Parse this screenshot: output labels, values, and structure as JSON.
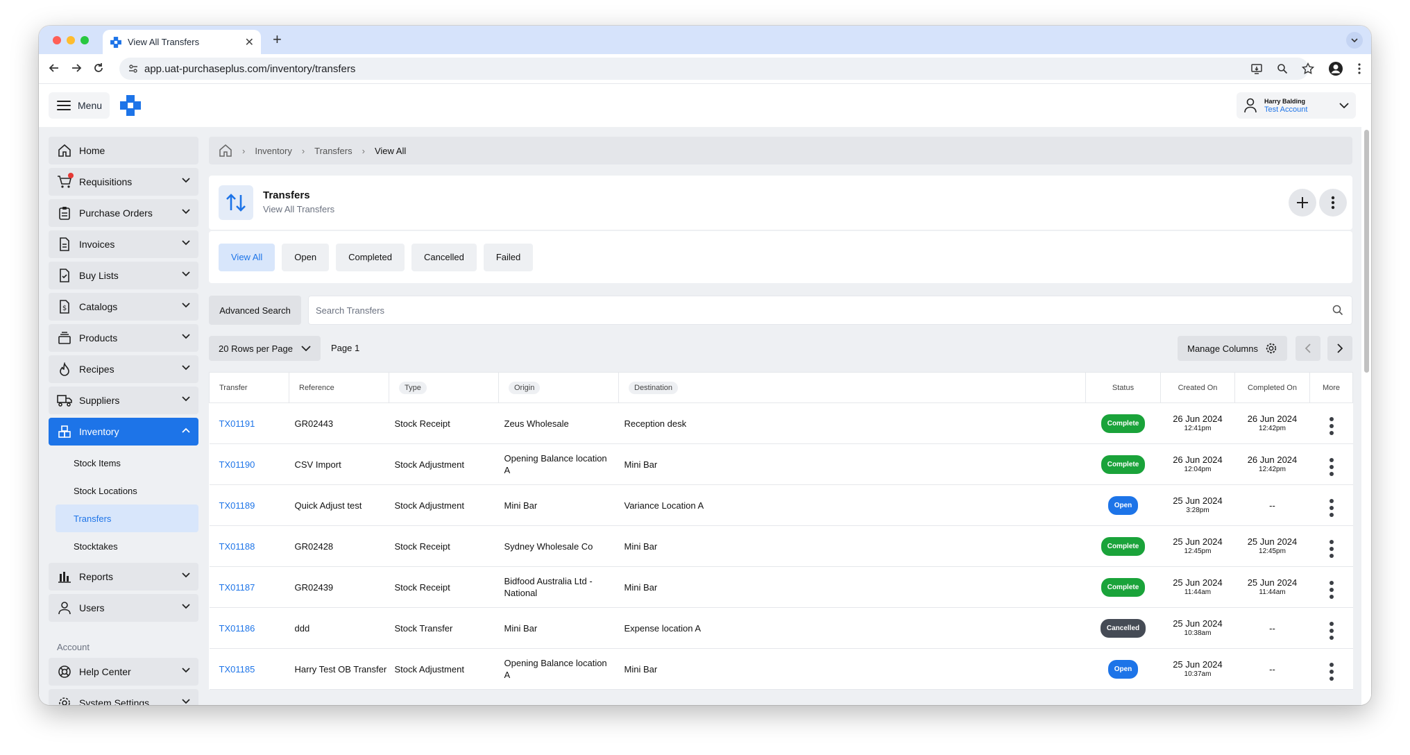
{
  "browser": {
    "tab_title": "View All Transfers",
    "url": "app.uat-purchaseplus.com/inventory/transfers"
  },
  "header": {
    "menu_label": "Menu",
    "user_name": "Harry Balding",
    "account_name": "Test Account"
  },
  "sidebar": {
    "items": [
      {
        "label": "Home",
        "icon": "home-icon"
      },
      {
        "label": "Requisitions",
        "icon": "cart-icon"
      },
      {
        "label": "Purchase Orders",
        "icon": "clipboard-icon"
      },
      {
        "label": "Invoices",
        "icon": "document-icon"
      },
      {
        "label": "Buy Lists",
        "icon": "checklist-icon"
      },
      {
        "label": "Catalogs",
        "icon": "dollar-doc-icon"
      },
      {
        "label": "Products",
        "icon": "stack-icon"
      },
      {
        "label": "Recipes",
        "icon": "flame-icon"
      },
      {
        "label": "Suppliers",
        "icon": "truck-icon"
      },
      {
        "label": "Inventory",
        "icon": "boxes-icon"
      }
    ],
    "inventory_sub": [
      "Stock Items",
      "Stock Locations",
      "Transfers",
      "Stocktakes"
    ],
    "more_items": [
      {
        "label": "Reports",
        "icon": "bar-chart-icon"
      },
      {
        "label": "Users",
        "icon": "user-icon"
      }
    ],
    "account_heading": "Account",
    "account_items": [
      {
        "label": "Help Center",
        "icon": "lifebuoy-icon"
      },
      {
        "label": "System Settings",
        "icon": "gear-icon"
      }
    ]
  },
  "breadcrumb": [
    "Inventory",
    "Transfers",
    "View All"
  ],
  "page": {
    "title": "Transfers",
    "subtitle": "View All Transfers"
  },
  "filters": [
    "View All",
    "Open",
    "Completed",
    "Cancelled",
    "Failed"
  ],
  "search": {
    "advanced_label": "Advanced Search",
    "placeholder": "Search Transfers"
  },
  "pagination": {
    "rows_per_page": "20 Rows per Page",
    "page_label": "Page 1",
    "manage_columns": "Manage Columns"
  },
  "table": {
    "headers": [
      "Transfer",
      "Reference",
      "Type",
      "Origin",
      "Destination",
      "Status",
      "Created On",
      "Completed On",
      "More"
    ],
    "rows": [
      {
        "transfer": "TX01191",
        "reference": "GR02443",
        "type": "Stock Receipt",
        "origin": "Zeus Wholesale",
        "destination": "Reception desk",
        "status": "Complete",
        "created_date": "26 Jun 2024",
        "created_time": "12:41pm",
        "completed_date": "26 Jun 2024",
        "completed_time": "12:42pm"
      },
      {
        "transfer": "TX01190",
        "reference": "CSV Import",
        "type": "Stock Adjustment",
        "origin": "Opening Balance location A",
        "destination": "Mini Bar",
        "status": "Complete",
        "created_date": "26 Jun 2024",
        "created_time": "12:04pm",
        "completed_date": "26 Jun 2024",
        "completed_time": "12:42pm"
      },
      {
        "transfer": "TX01189",
        "reference": "Quick Adjust test",
        "type": "Stock Adjustment",
        "origin": "Mini Bar",
        "destination": "Variance Location A",
        "status": "Open",
        "created_date": "25 Jun 2024",
        "created_time": "3:28pm",
        "completed_date": "--",
        "completed_time": ""
      },
      {
        "transfer": "TX01188",
        "reference": "GR02428",
        "type": "Stock Receipt",
        "origin": "Sydney Wholesale Co",
        "destination": "Mini Bar",
        "status": "Complete",
        "created_date": "25 Jun 2024",
        "created_time": "12:45pm",
        "completed_date": "25 Jun 2024",
        "completed_time": "12:45pm"
      },
      {
        "transfer": "TX01187",
        "reference": "GR02439",
        "type": "Stock Receipt",
        "origin": "Bidfood Australia Ltd - National",
        "destination": "Mini Bar",
        "status": "Complete",
        "created_date": "25 Jun 2024",
        "created_time": "11:44am",
        "completed_date": "25 Jun 2024",
        "completed_time": "11:44am"
      },
      {
        "transfer": "TX01186",
        "reference": "ddd",
        "type": "Stock Transfer",
        "origin": "Mini Bar",
        "destination": "Expense location A",
        "status": "Cancelled",
        "created_date": "25 Jun 2024",
        "created_time": "10:38am",
        "completed_date": "--",
        "completed_time": ""
      },
      {
        "transfer": "TX01185",
        "reference": "Harry Test OB Transfer",
        "type": "Stock Adjustment",
        "origin": "Opening Balance location A",
        "destination": "Mini Bar",
        "status": "Open",
        "created_date": "25 Jun 2024",
        "created_time": "10:37am",
        "completed_date": "--",
        "completed_time": ""
      }
    ]
  },
  "colors": {
    "accent": "#1d74e8",
    "complete": "#1aa33a",
    "open": "#1d74e8",
    "cancelled": "#454b55"
  }
}
